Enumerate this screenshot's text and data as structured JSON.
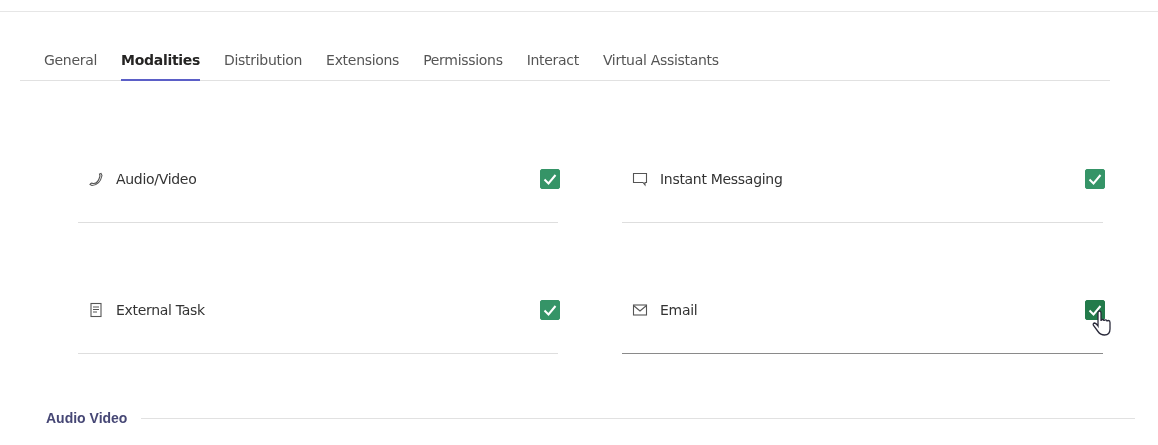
{
  "tabs": [
    {
      "label": "General",
      "selected": false
    },
    {
      "label": "Modalities",
      "selected": true
    },
    {
      "label": "Distribution",
      "selected": false
    },
    {
      "label": "Extensions",
      "selected": false
    },
    {
      "label": "Permissions",
      "selected": false
    },
    {
      "label": "Interact",
      "selected": false
    },
    {
      "label": "Virtual Assistants",
      "selected": false
    }
  ],
  "modalities": [
    {
      "kind": "phone",
      "label": "Audio/Video",
      "checked": true,
      "hovered": false
    },
    {
      "kind": "chat",
      "label": "Instant Messaging",
      "checked": true,
      "hovered": false
    },
    {
      "kind": "task",
      "label": "External Task",
      "checked": true,
      "hovered": false
    },
    {
      "kind": "email",
      "label": "Email",
      "checked": true,
      "hovered": true
    }
  ],
  "section": {
    "title": "Audio Video"
  }
}
